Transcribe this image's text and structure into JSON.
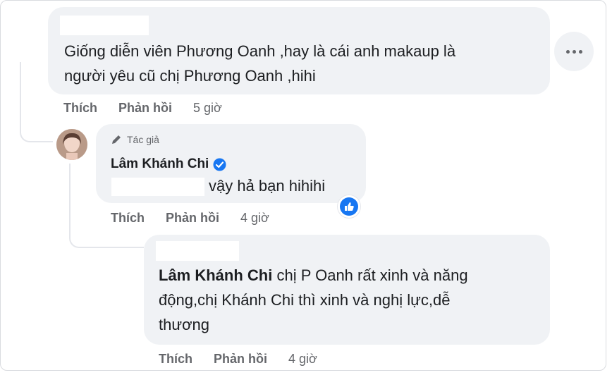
{
  "comments": [
    {
      "text_line1": "Giống diễn viên Phương Oanh ,hay là cái anh makaup là",
      "text_line2": "người yêu cũ chị Phương Oanh ,hihi",
      "actions": {
        "like": "Thích",
        "reply": "Phản hồi",
        "time": "5 giờ"
      }
    },
    {
      "author_badge": "Tác giả",
      "author_name": "Lâm Khánh Chi",
      "text": "vậy hả bạn hihihi",
      "reaction": "like-icon",
      "actions": {
        "like": "Thích",
        "reply": "Phản hồi",
        "time": "4 giờ"
      }
    },
    {
      "mention": "Lâm Khánh Chi",
      "text_line1": "chị P Oanh rất xinh và năng",
      "text_line2": "động,chị Khánh Chi thì xinh và nghị lực,dễ",
      "text_line3": "thương",
      "actions": {
        "like": "Thích",
        "reply": "Phản hồi",
        "time": "4 giờ"
      }
    }
  ],
  "colors": {
    "bubble": "#f0f2f5",
    "text": "#1c1e21",
    "secondary": "#65676b",
    "verified": "#1877f2"
  }
}
